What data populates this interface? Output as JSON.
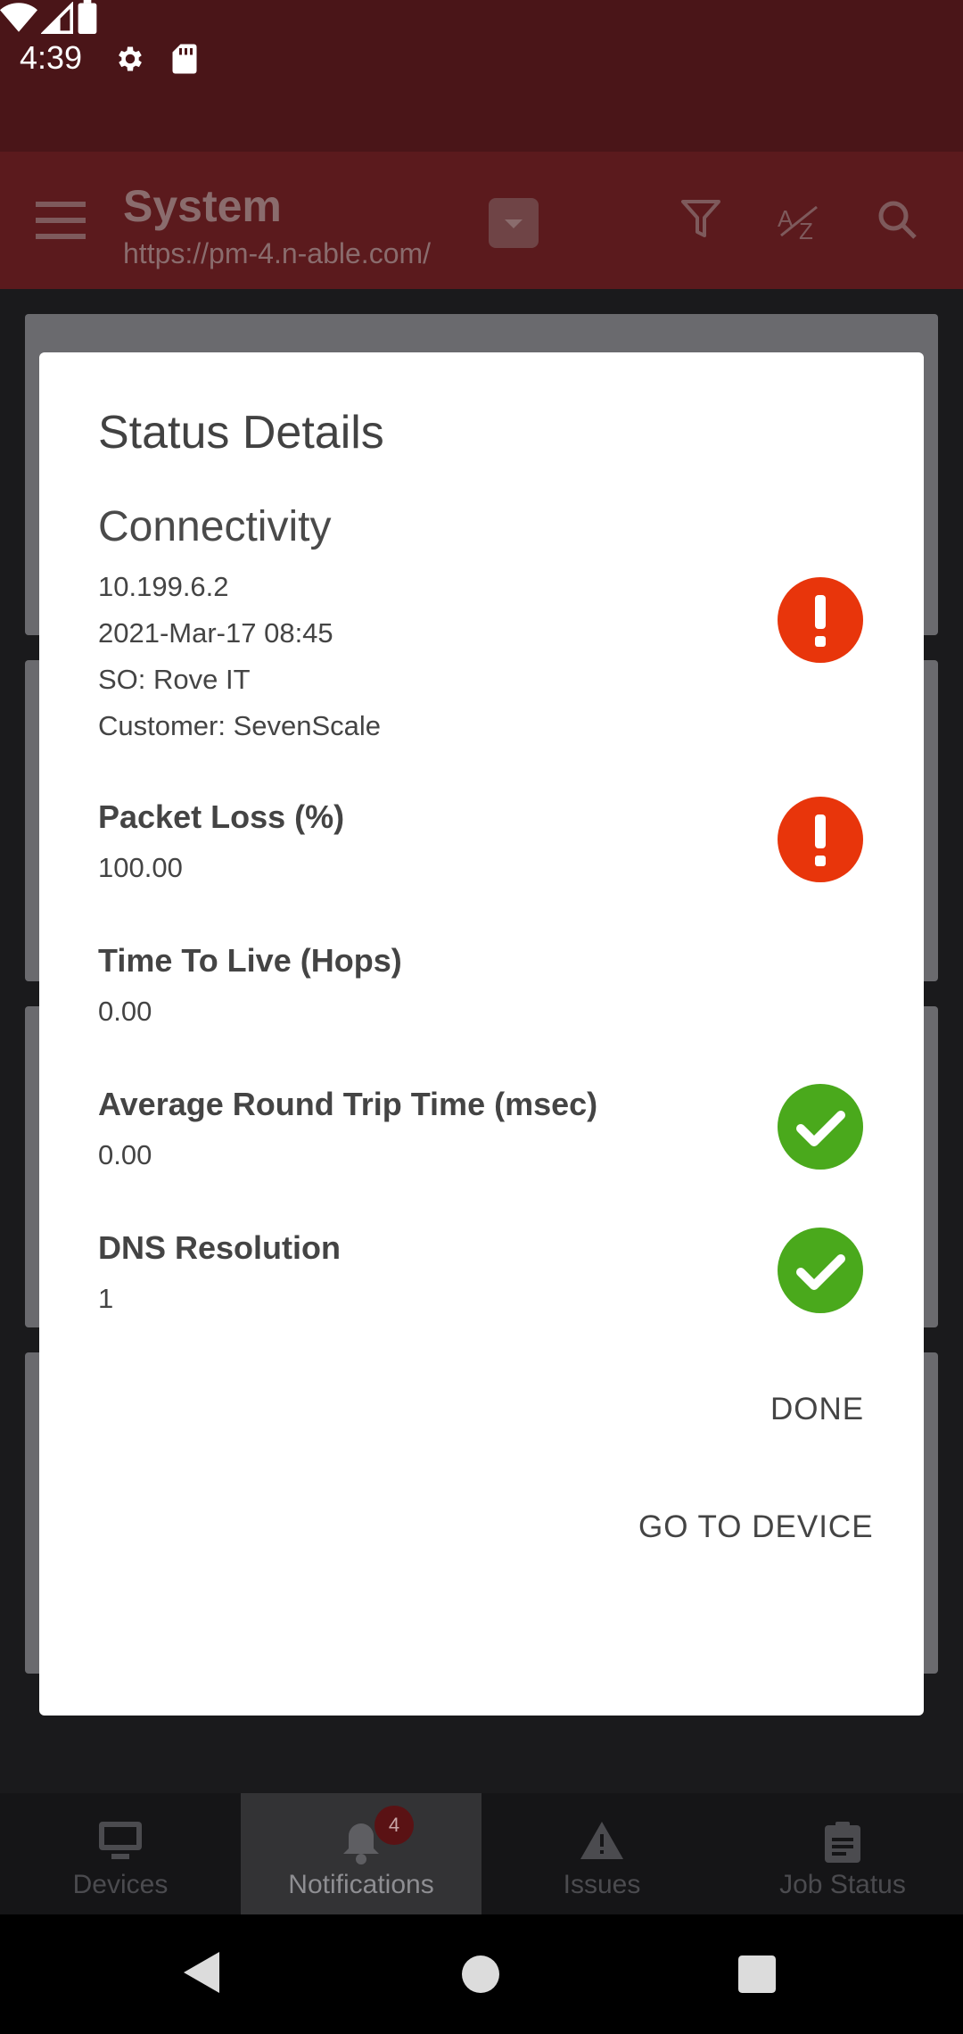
{
  "status_bar": {
    "time": "4:39"
  },
  "toolbar": {
    "title": "System",
    "subtitle": "https://pm-4.n-able.com/"
  },
  "dialog": {
    "title": "Status Details",
    "section_title": "Connectivity",
    "info_lines": [
      "10.199.6.2",
      "2021-Mar-17 08:45",
      "SO: Rove IT",
      "Customer: SevenScale"
    ],
    "metrics": [
      {
        "label": "Packet Loss (%)",
        "value": "100.00",
        "status": "error"
      },
      {
        "label": "Time To Live (Hops)",
        "value": "0.00",
        "status": "none"
      },
      {
        "label": "Average Round Trip Time (msec)",
        "value": "0.00",
        "status": "ok"
      },
      {
        "label": "DNS Resolution",
        "value": "1",
        "status": "ok"
      }
    ],
    "connectivity_status": "error",
    "done_label": "DONE",
    "go_to_device_label": "GO TO DEVICE"
  },
  "bottom_nav": {
    "items": [
      {
        "label": "Devices",
        "icon": "monitor-icon"
      },
      {
        "label": "Notifications",
        "icon": "bell-icon",
        "badge": "4",
        "active": true
      },
      {
        "label": "Issues",
        "icon": "warning-icon"
      },
      {
        "label": "Job Status",
        "icon": "clipboard-icon"
      }
    ]
  },
  "colors": {
    "status_bar": "#4a1518",
    "toolbar": "#5b1a1d",
    "error": "#e8350b",
    "ok": "#4aa91c"
  }
}
